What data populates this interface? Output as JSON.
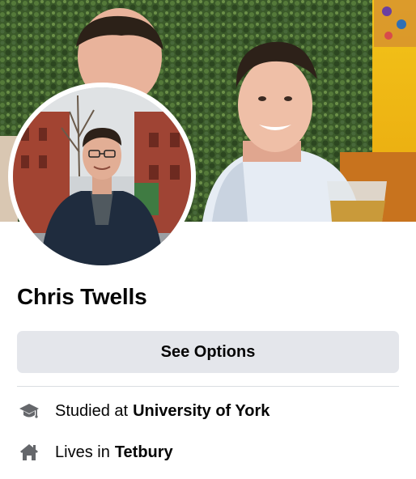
{
  "profile": {
    "name": "Chris Twells"
  },
  "actions": {
    "see_options_label": "See Options"
  },
  "intro": {
    "education": {
      "icon": "graduation-cap-icon",
      "prefix": "Studied at",
      "value": "University of York"
    },
    "residence": {
      "icon": "home-icon",
      "prefix": "Lives in",
      "value": "Tetbury"
    }
  },
  "colors": {
    "button_bg": "#e4e6eb",
    "text": "#050505",
    "icon": "#65676b",
    "divider": "#dadde1"
  }
}
